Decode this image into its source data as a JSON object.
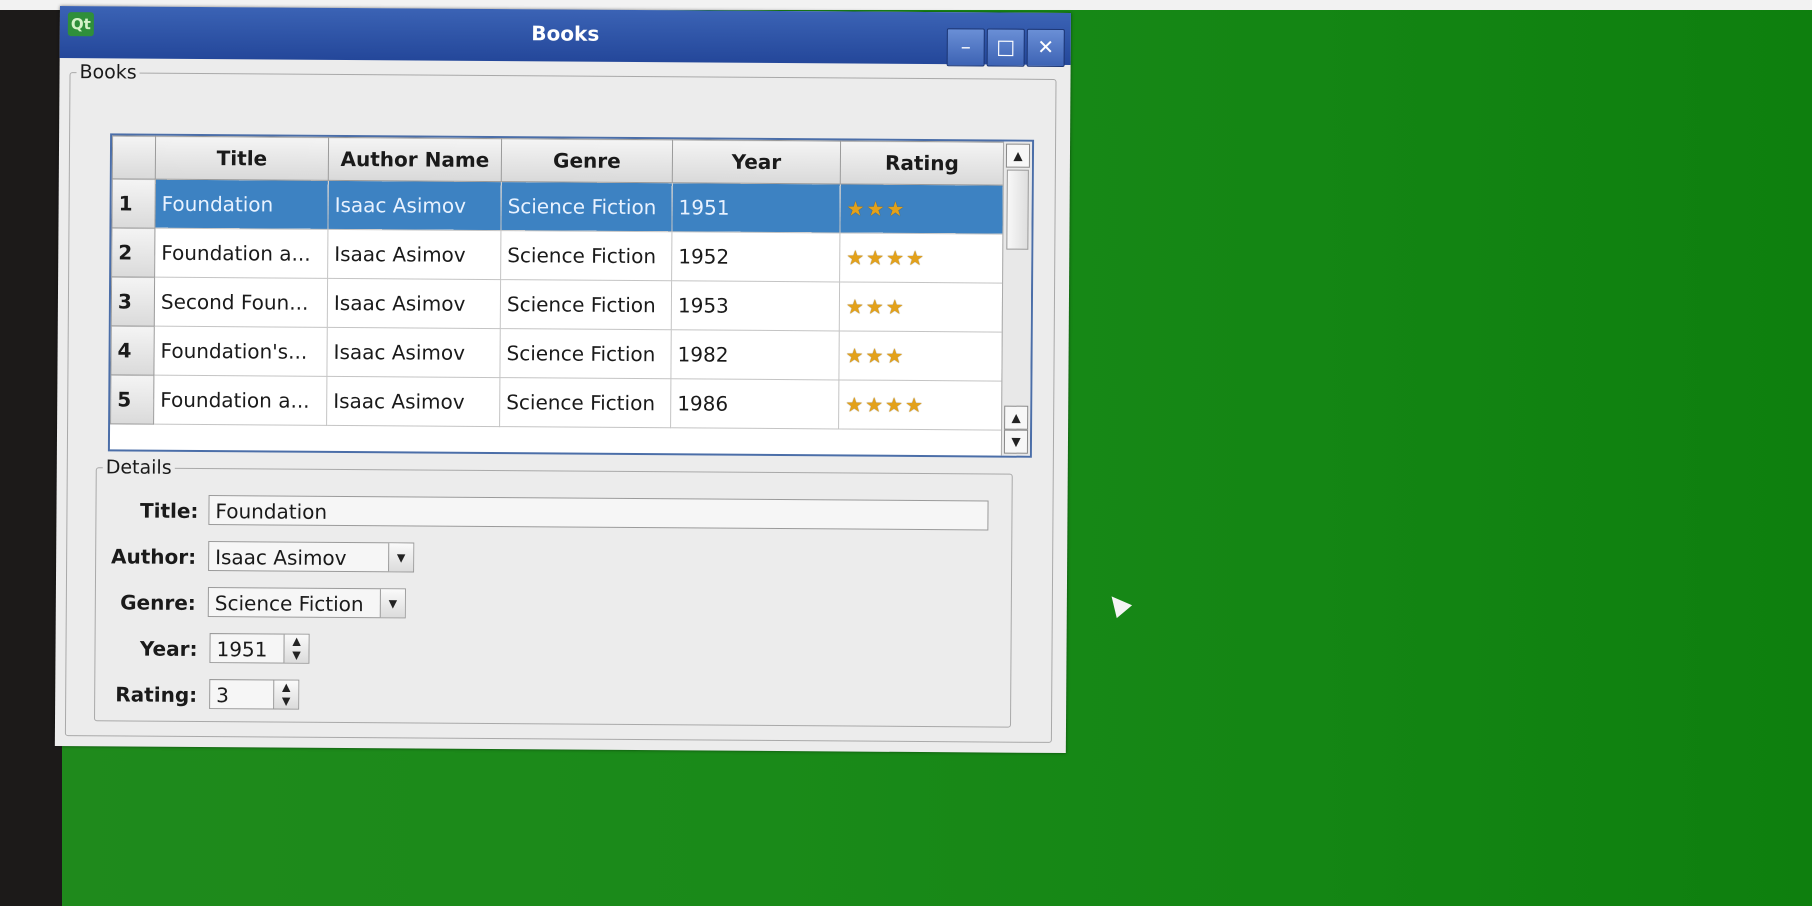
{
  "window": {
    "title": "Books",
    "logo_text": "Qt",
    "minimize_glyph": "–",
    "maximize_glyph": "□",
    "close_glyph": "✕"
  },
  "books_group": {
    "label": "Books"
  },
  "table": {
    "columns": [
      "Title",
      "Author Name",
      "Genre",
      "Year",
      "Rating"
    ],
    "rows": [
      {
        "num": "1",
        "title": "Foundation",
        "author": "Isaac Asimov",
        "genre": "Science Fiction",
        "year": "1951",
        "rating": 3,
        "selected": true
      },
      {
        "num": "2",
        "title": "Foundation a...",
        "author": "Isaac Asimov",
        "genre": "Science Fiction",
        "year": "1952",
        "rating": 4,
        "selected": false
      },
      {
        "num": "3",
        "title": "Second Foun...",
        "author": "Isaac Asimov",
        "genre": "Science Fiction",
        "year": "1953",
        "rating": 3,
        "selected": false
      },
      {
        "num": "4",
        "title": "Foundation's...",
        "author": "Isaac Asimov",
        "genre": "Science Fiction",
        "year": "1982",
        "rating": 3,
        "selected": false
      },
      {
        "num": "5",
        "title": "Foundation a...",
        "author": "Isaac Asimov",
        "genre": "Science Fiction",
        "year": "1986",
        "rating": 4,
        "selected": false
      }
    ]
  },
  "details_group": {
    "label": "Details"
  },
  "details": {
    "title_label": "Title:",
    "title_value": "Foundation",
    "author_label": "Author:",
    "author_value": "Isaac Asimov",
    "genre_label": "Genre:",
    "genre_value": "Science Fiction",
    "year_label": "Year:",
    "year_value": "1951",
    "rating_label": "Rating:",
    "rating_value": "3"
  },
  "icons": {
    "star": "★",
    "scroll_up": "▲",
    "scroll_down": "▼",
    "combo_arrow": "▼"
  },
  "colors": {
    "selection": "#3d82c2",
    "titlebar": "#2f57a8",
    "desktop": "#1a8a19",
    "star": "#e3a11a"
  }
}
